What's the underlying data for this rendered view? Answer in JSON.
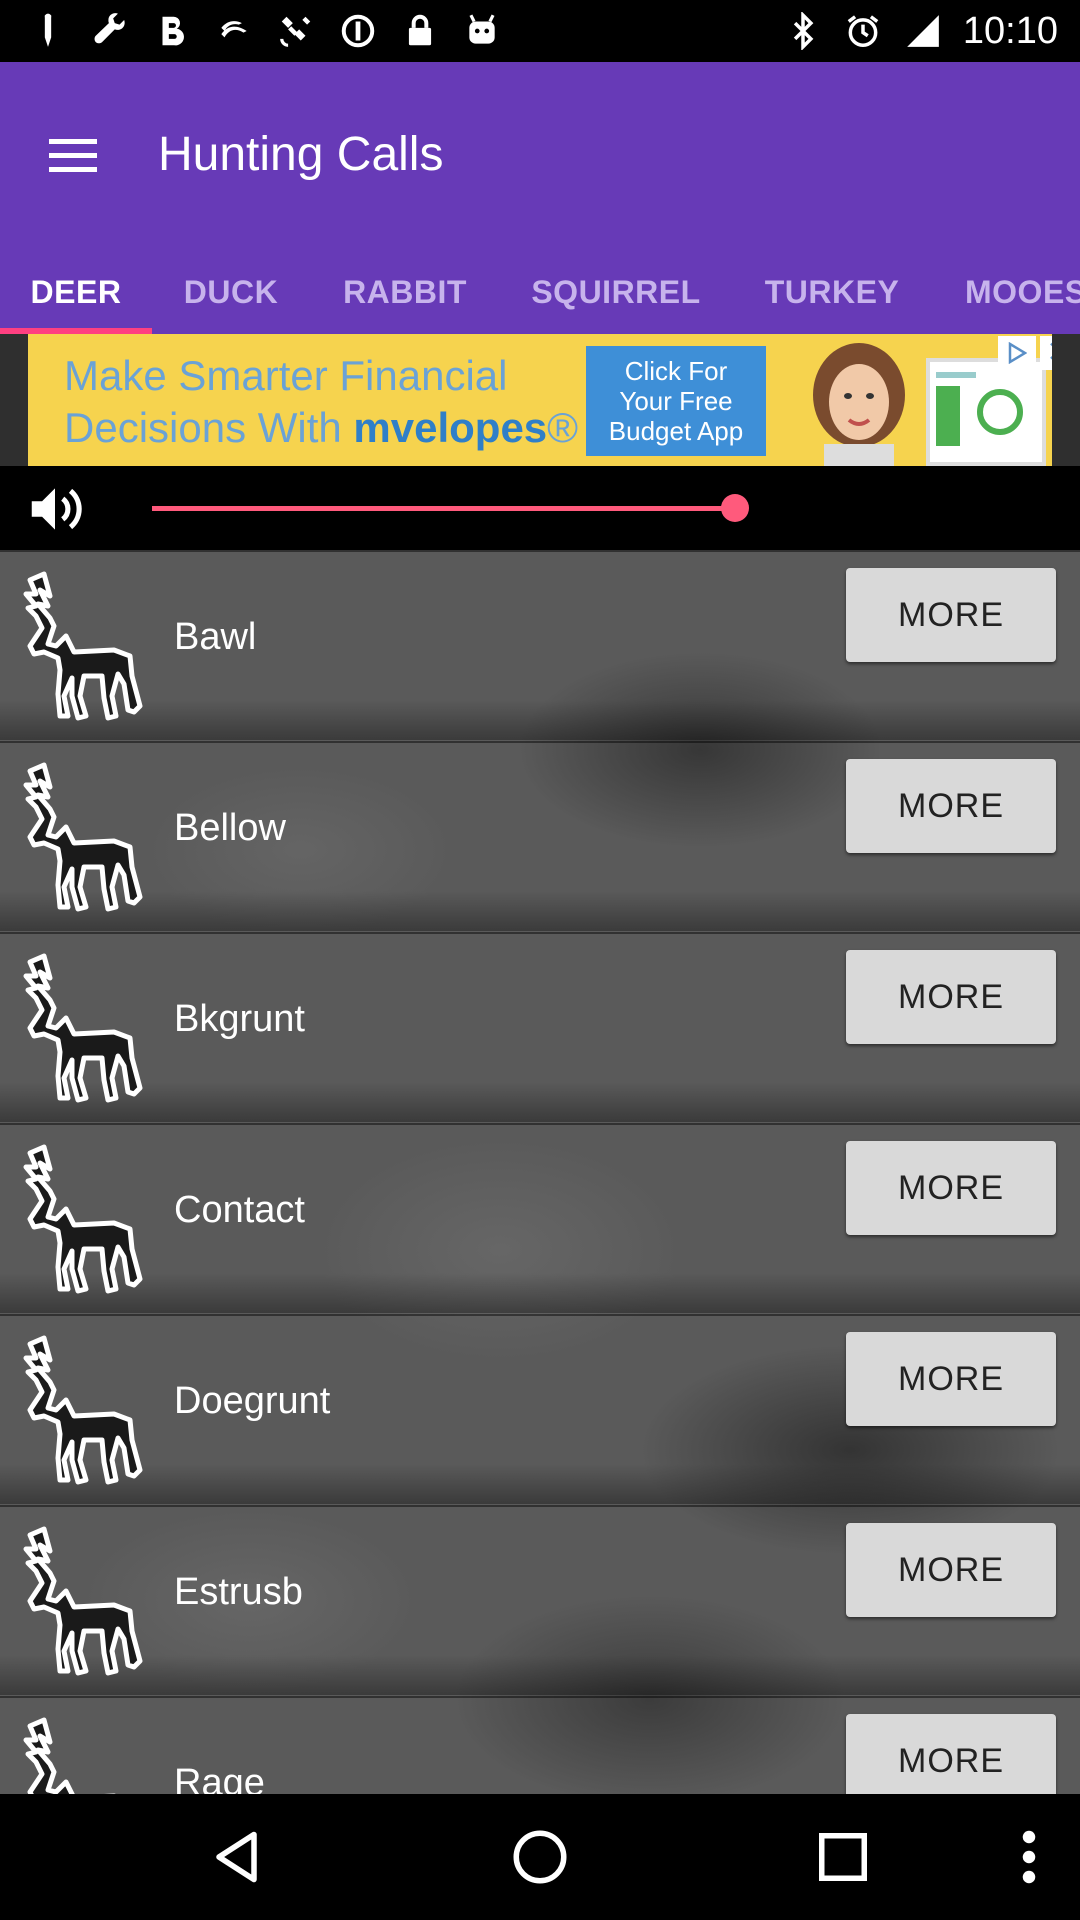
{
  "status_bar": {
    "time": "10:10",
    "left_icons": [
      "notification-icon",
      "wrench-icon",
      "bold-b-icon",
      "swipe-icon",
      "satellite-icon",
      "sync-icon",
      "lock-icon",
      "android-icon"
    ],
    "right_icons": [
      "bluetooth-icon",
      "alarm-icon",
      "signal-icon"
    ]
  },
  "app_bar": {
    "title": "Hunting Calls",
    "color": "#673ab7"
  },
  "tabs": [
    {
      "label": "DEER",
      "active": true
    },
    {
      "label": "DUCK",
      "active": false
    },
    {
      "label": "RABBIT",
      "active": false
    },
    {
      "label": "SQUIRREL",
      "active": false
    },
    {
      "label": "TURKEY",
      "active": false
    },
    {
      "label": "MOOES",
      "active": false
    }
  ],
  "ad": {
    "line1": "Make Smarter Financial",
    "line2_prefix": "Decisions With ",
    "brand": "mvelopes",
    "brand_suffix": "®",
    "cta": "Click For Your Free Budget App",
    "close": "✕"
  },
  "volume": {
    "level": 0.81,
    "accent": "#ff5a7c"
  },
  "calls": [
    {
      "name": "Bawl",
      "button": "MORE"
    },
    {
      "name": "Bellow",
      "button": "MORE"
    },
    {
      "name": "Bkgrunt",
      "button": "MORE"
    },
    {
      "name": "Contact",
      "button": "MORE"
    },
    {
      "name": "Doegrunt",
      "button": "MORE"
    },
    {
      "name": "Estrusb",
      "button": "MORE"
    },
    {
      "name": "Rage",
      "button": "MORE"
    }
  ],
  "nav_bar": {
    "buttons": [
      "back-icon",
      "home-icon",
      "recents-icon",
      "overflow-menu-icon"
    ]
  }
}
